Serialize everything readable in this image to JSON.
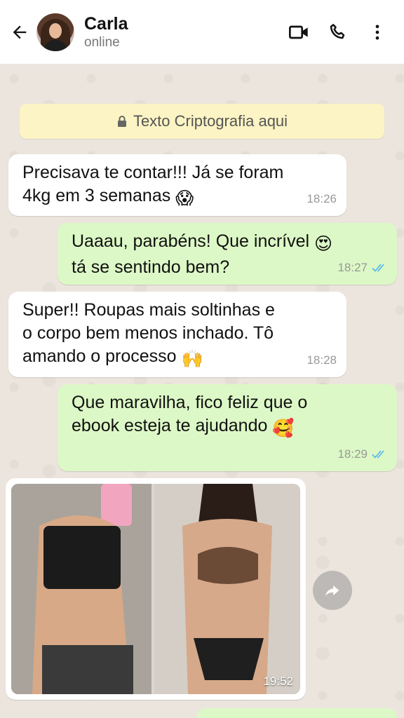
{
  "header": {
    "contact_name": "Carla",
    "contact_status": "online",
    "icons": [
      "back-arrow-icon",
      "video-call-icon",
      "phone-icon",
      "more-vert-icon"
    ]
  },
  "system_notice": {
    "text": "Texto Criptografia aqui",
    "icon": "lock-icon"
  },
  "messages": [
    {
      "direction": "incoming",
      "text": "Precisava te contar!!! Já se foram 4kg em 3 semanas",
      "emoji": "😱",
      "time": "18:26"
    },
    {
      "direction": "outgoing",
      "text": "Uaaau, parabéns! Que incrível",
      "emoji": "😍",
      "text_after": "tá se sentindo bem?",
      "time": "18:27",
      "status": "read"
    },
    {
      "direction": "incoming",
      "text": "Super!! Roupas mais soltinhas e o corpo bem menos inchado. Tô amando o processo",
      "emoji": "🙌",
      "time": "18:28"
    },
    {
      "direction": "outgoing",
      "text": "Que maravilha, fico feliz que o ebook esteja te ajudando",
      "emoji": "🥰",
      "time": "18:29",
      "status": "read"
    },
    {
      "direction": "incoming",
      "type": "image",
      "time": "19:52"
    }
  ],
  "colors": {
    "chat_bg": "#ece5dd",
    "incoming_bubble": "#ffffff",
    "outgoing_bubble": "#dcf8c6",
    "notice_bg": "#fcf4c4",
    "read_ticks": "#4fb6ec"
  }
}
